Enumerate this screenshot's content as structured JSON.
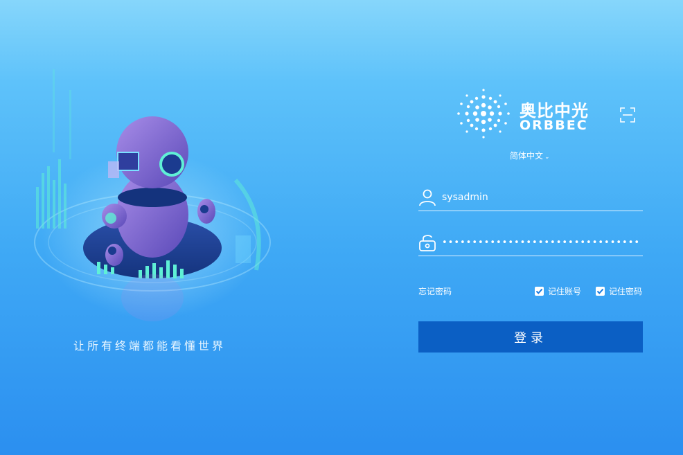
{
  "slogan": "让所有终端都能看懂世界",
  "brand": {
    "name_cn": "奥比中光",
    "name_en": "ORBBEC"
  },
  "language": {
    "current": "简体中文",
    "chevron": "chevron-down-icon"
  },
  "login_form": {
    "username_value": "sysadmin",
    "password_value": "••••••••••••••••••••••••••••••••••••••••••",
    "forgot_password": "忘记密码",
    "remember_account_label": "记住账号",
    "remember_account_checked": true,
    "remember_password_label": "记住密码",
    "remember_password_checked": true,
    "submit_label": "登录"
  },
  "icons": {
    "user": "user-icon",
    "lock": "lock-icon",
    "scan": "scan-icon"
  },
  "colors": {
    "button": "#0b5fc4",
    "checkbox_check": "#1479e0"
  }
}
